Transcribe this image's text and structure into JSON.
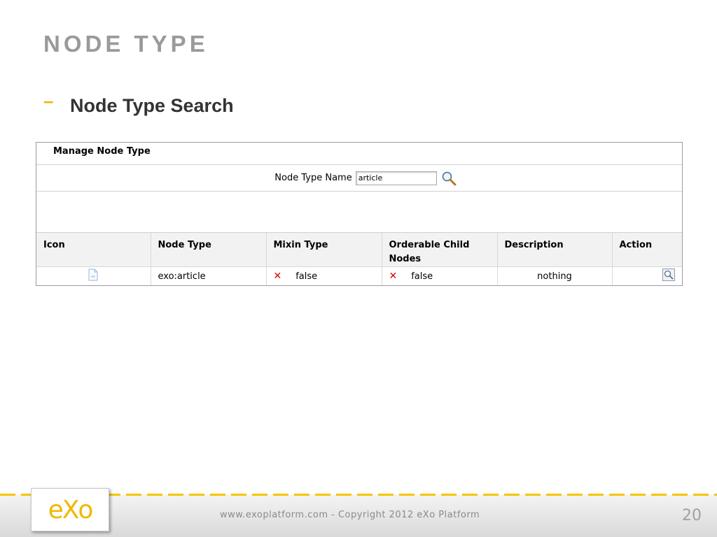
{
  "slide": {
    "title": "NODE TYPE",
    "bullet": "Node Type Search"
  },
  "panel": {
    "header": "Manage Node Type",
    "search_label": "Node Type Name",
    "search_value": "article",
    "columns": [
      "Icon",
      "Node Type",
      "Mixin Type",
      "Orderable Child Nodes",
      "Description",
      "Action"
    ],
    "rows": [
      {
        "icon": "document-icon",
        "node_type": "exo:article",
        "mixin_type": "false",
        "orderable_child_nodes": "false",
        "description": "nothing",
        "action": "view-icon"
      }
    ]
  },
  "footer": {
    "logo": "eXo",
    "copyright": "www.exoplatform.com - Copyright 2012 eXo Platform",
    "page_number": "20"
  },
  "colors": {
    "title": "#9a9a9a",
    "bullet_dash": "#f0b400",
    "false_mark": "#d40000",
    "accent": "#f4c400"
  }
}
